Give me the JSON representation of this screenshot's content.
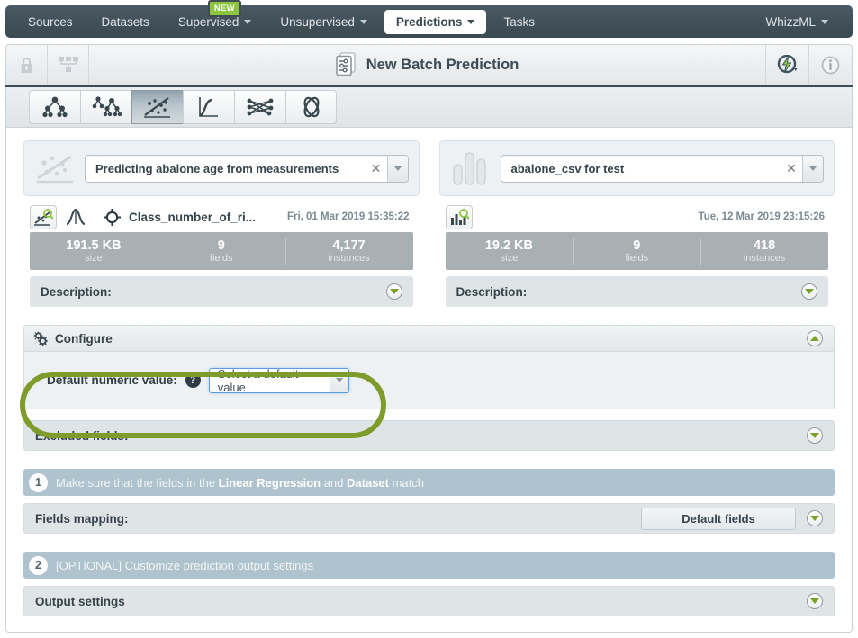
{
  "nav": {
    "items": [
      {
        "label": "Sources",
        "caret": false,
        "active": false,
        "badge": null
      },
      {
        "label": "Datasets",
        "caret": false,
        "active": false,
        "badge": null
      },
      {
        "label": "Supervised",
        "caret": true,
        "active": false,
        "badge": "NEW"
      },
      {
        "label": "Unsupervised",
        "caret": true,
        "active": false,
        "badge": null
      },
      {
        "label": "Predictions",
        "caret": true,
        "active": true,
        "badge": null
      },
      {
        "label": "Tasks",
        "caret": false,
        "active": false,
        "badge": null
      }
    ],
    "right": {
      "label": "WhizzML",
      "caret": true
    }
  },
  "header": {
    "title": "New Batch Prediction",
    "lock_icon": "lock-icon",
    "share_icon": "share-network-icon",
    "whizzml_icon": "whizzml-lightning-icon",
    "info_icon": "info-icon",
    "title_icon": "batch-prediction-icon"
  },
  "model_types": [
    {
      "name": "model",
      "selected": false
    },
    {
      "name": "ensemble",
      "selected": false
    },
    {
      "name": "linear-regression",
      "selected": true
    },
    {
      "name": "logistic-regression",
      "selected": false
    },
    {
      "name": "deepnet",
      "selected": false
    },
    {
      "name": "fusion",
      "selected": false
    }
  ],
  "model_panel": {
    "resource_icon": "linear-regression-icon",
    "selected": "Predicting abalone age from measurements",
    "clear_label": "✕",
    "view_icon": "linear-regression-view-icon",
    "distribution_icon": "distribution-curve-icon",
    "objective_icon": "objective-target-icon",
    "objective_field": "Class_number_of_ri...",
    "date": "Fri, 01 Mar 2019 15:35:22",
    "stats": [
      {
        "value": "191.5 KB",
        "label": "size"
      },
      {
        "value": "9",
        "label": "fields"
      },
      {
        "value": "4,177",
        "label": "instances"
      }
    ],
    "description_label": "Description:"
  },
  "dataset_panel": {
    "resource_icon": "dataset-bars-icon",
    "selected": "abalone_csv for test",
    "clear_label": "✕",
    "view_icon": "dataset-search-icon",
    "date": "Tue, 12 Mar 2019 23:15:26",
    "stats": [
      {
        "value": "19.2 KB",
        "label": "size"
      },
      {
        "value": "9",
        "label": "fields"
      },
      {
        "value": "418",
        "label": "instances"
      }
    ],
    "description_label": "Description:"
  },
  "configure": {
    "title": "Configure",
    "gear_icon": "gears-icon",
    "default_numeric_label": "Default numeric value:",
    "help_icon": "help-question-icon",
    "help_glyph": "?",
    "select_value": "Select a default value",
    "highlight_color": "#7d9c2b"
  },
  "excluded_fields": {
    "label": "Excluded fields:"
  },
  "step1": {
    "number": "1",
    "text_pre": "Make sure that the fields in the ",
    "bold1": "Linear Regression",
    "text_mid": " and ",
    "bold2": "Dataset",
    "text_post": " match"
  },
  "fields_mapping": {
    "label": "Fields mapping:",
    "button": "Default fields"
  },
  "step2": {
    "number": "2",
    "text": "[OPTIONAL] Customize prediction output settings"
  },
  "output_settings": {
    "label": "Output settings"
  }
}
